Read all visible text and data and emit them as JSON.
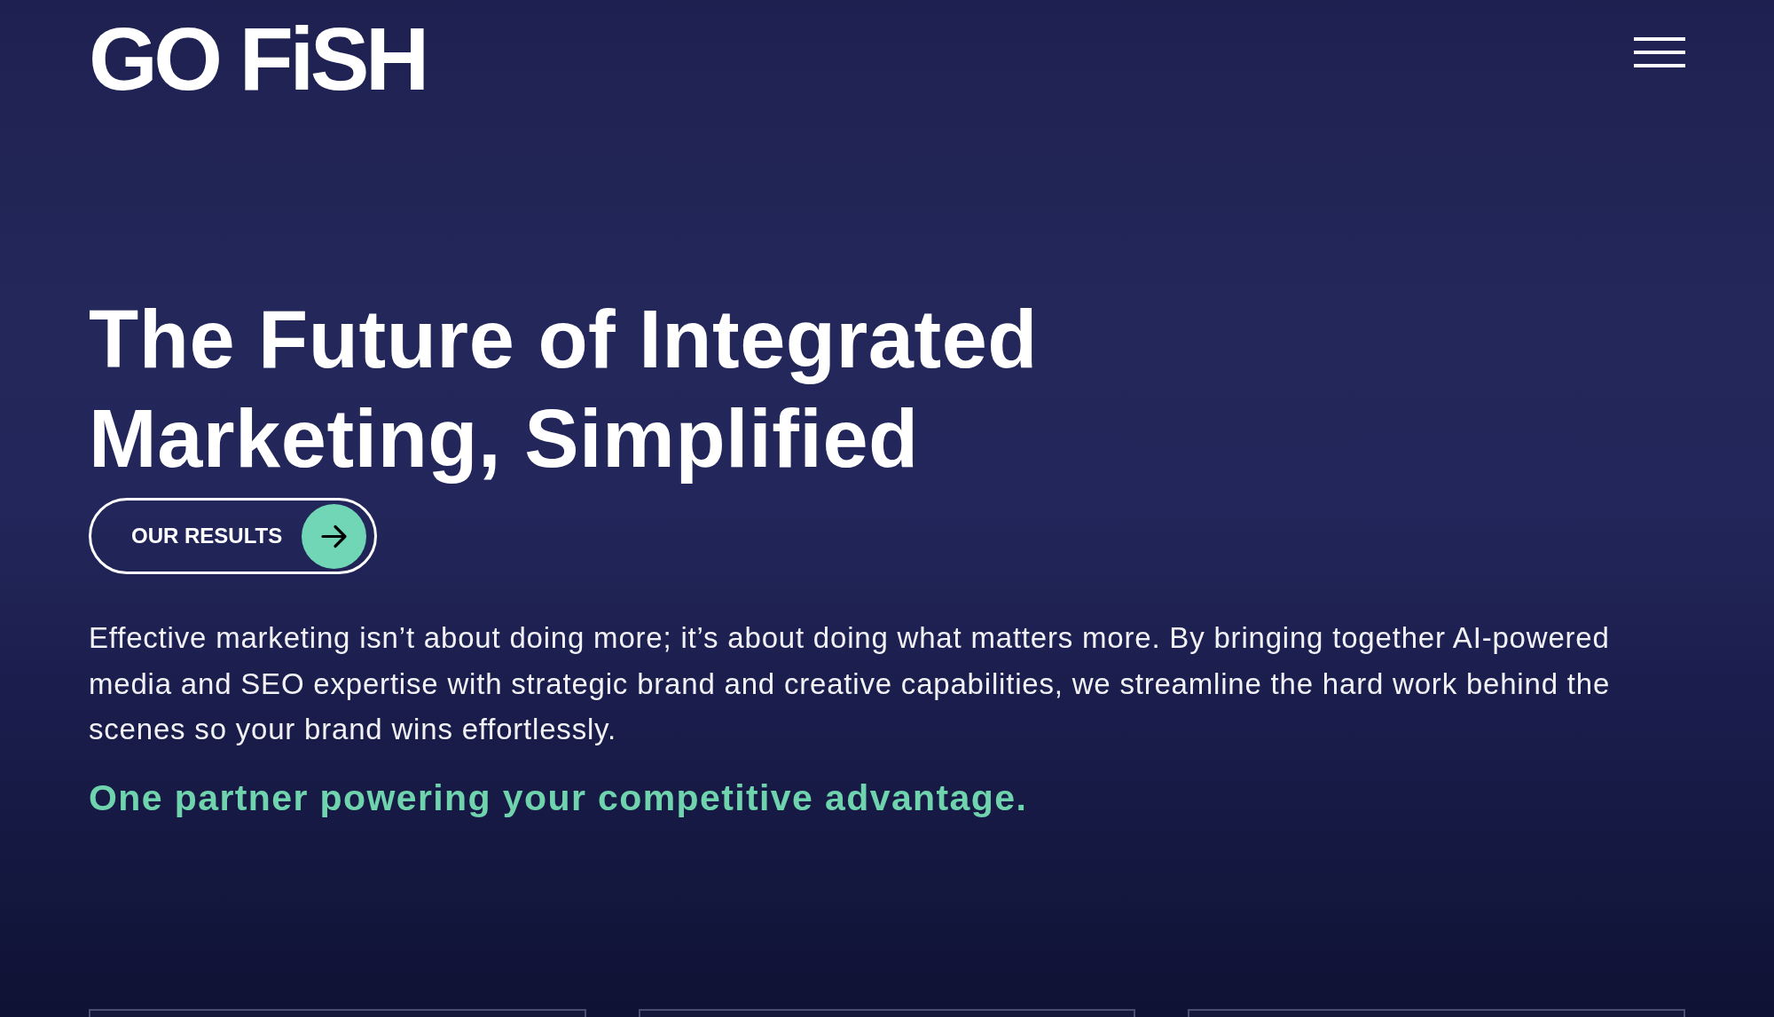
{
  "header": {
    "logo": "GO FiSH"
  },
  "hero": {
    "headline": "The Future of Integrated Marketing, Simplified",
    "cta_button": {
      "label": "OUR RESULTS"
    },
    "intro": "Effective marketing isn’t about doing more; it’s about doing what matters more. By bringing together AI-powered media and SEO expertise with strategic brand and creative capabilities, we streamline the hard work behind the scenes so your brand wins effortlessly.",
    "tagline": "One partner powering your competitive advantage."
  }
}
